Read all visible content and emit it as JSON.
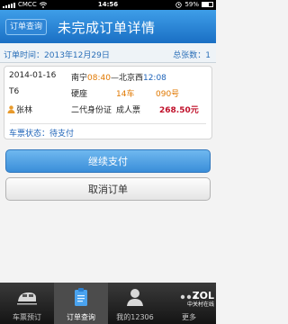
{
  "status_bar": {
    "carrier": "CMCC",
    "time": "14:56",
    "battery": "59%"
  },
  "header": {
    "back_label": "订单查询",
    "title": "未完成订单详情"
  },
  "order_info": {
    "date_label": "订单时间：",
    "date_value": "2013年12月29日",
    "total_label": "总张数：",
    "total_value": "1"
  },
  "ticket": {
    "travel_date": "2014-01-16",
    "from_station": "南宁",
    "depart_time": "08:40",
    "separator": "—",
    "to_station": "北京西",
    "arrive_time": "12:08",
    "train_no": "T6",
    "seat_type": "硬座",
    "car": "14车",
    "seat": "090号",
    "passenger": "张林",
    "id_type": "二代身份证",
    "ticket_type": "成人票",
    "price": "268.50元",
    "status_label": "车票状态：",
    "status_value": "待支付"
  },
  "actions": {
    "pay": "继续支付",
    "cancel": "取消订单"
  },
  "tabs": [
    {
      "label": "车票预订",
      "icon": "train-icon",
      "active": false
    },
    {
      "label": "订单查询",
      "icon": "clipboard-icon",
      "active": true
    },
    {
      "label": "我的12306",
      "icon": "user-icon",
      "active": false
    },
    {
      "label": "更多",
      "icon": "more-icon",
      "active": false
    }
  ],
  "watermark": {
    "brand": "ZOL",
    "text": "中关村在线"
  },
  "colors": {
    "header": "#1a6fc4",
    "accent_blue": "#1e63b8",
    "orange": "#e07800",
    "price_red": "#c0102a"
  }
}
